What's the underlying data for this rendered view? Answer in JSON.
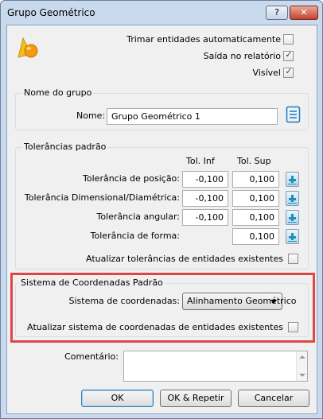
{
  "window": {
    "title": "Grupo Geométrico",
    "help_label": "?",
    "close_label": "✕"
  },
  "options": {
    "trim_label": "Trimar entidades automaticamente",
    "trim_checked": false,
    "report_label": "Saída no relatório",
    "report_checked": true,
    "visible_label": "Visível",
    "visible_checked": true
  },
  "group_name": {
    "legend": "Nome do grupo",
    "name_label": "Nome:",
    "name_value": "Grupo Geométrico 1"
  },
  "tolerances": {
    "legend": "Tolerâncias padrão",
    "col_inf": "Tol. Inf",
    "col_sup": "Tol. Sup",
    "rows": [
      {
        "label": "Tolerância de posição:",
        "inf": "-0,100",
        "sup": "0,100"
      },
      {
        "label": "Tolerância Dimensional/Diamétrica:",
        "inf": "-0,100",
        "sup": "0,100"
      },
      {
        "label": "Tolerância angular:",
        "inf": "-0,100",
        "sup": "0,100"
      },
      {
        "label": "Tolerância de forma:",
        "inf": "",
        "sup": "0,100"
      }
    ],
    "update_label": "Atualizar tolerâncias de entidades existentes",
    "update_checked": false
  },
  "coords": {
    "legend": "Sistema de Coordenadas Padrão",
    "system_label": "Sistema de coordenadas:",
    "system_value": "Alinhamento Geométrico",
    "update_label": "Atualizar sistema de coordenadas de entidades existentes",
    "update_checked": false
  },
  "comment": {
    "label": "Comentário:",
    "value": ""
  },
  "buttons": {
    "ok": "OK",
    "ok_repeat": "OK & Repetir",
    "cancel": "Cancelar"
  },
  "colors": {
    "highlight": "#e04646",
    "title_bar": "#c9daee",
    "close_button": "#c4412e"
  }
}
